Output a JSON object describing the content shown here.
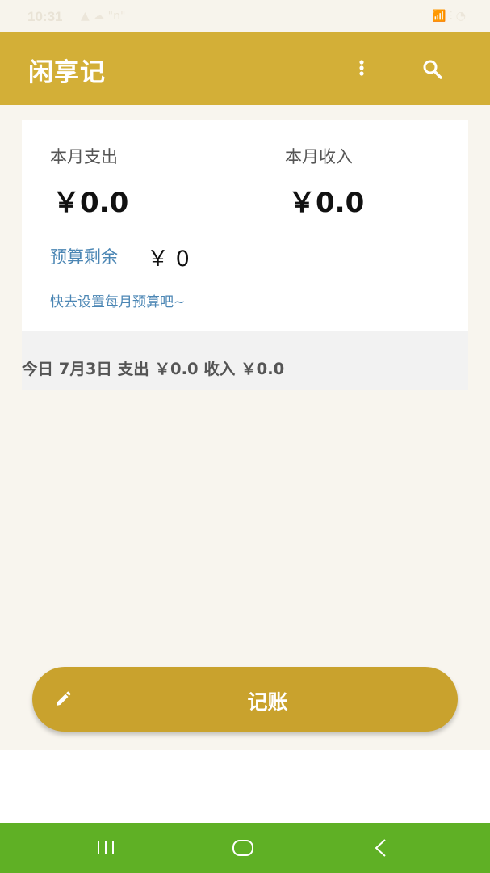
{
  "status_bar": {
    "time": "10:31",
    "left_icons": "▲ ☁ \"n\"",
    "right_icons": "📶 ⫶ ◔"
  },
  "app_bar": {
    "title": "闲享记",
    "icons": [
      "more-vert-icon",
      "search-icon"
    ]
  },
  "summary": {
    "expense_label": "本月支出",
    "expense_value": "￥0.0",
    "income_label": "本月收入",
    "income_value": "￥0.0",
    "budget_label": "预算剩余",
    "budget_value": "￥ 0",
    "budget_hint": "快去设置每月预算吧~"
  },
  "today": {
    "text": "今日 7月3日 支出 ￥0.0  收入 ￥0.0"
  },
  "record_button": {
    "label": "记账",
    "icon": "pencil-icon"
  },
  "nav": {
    "icons": [
      "recent-apps-icon",
      "home-icon",
      "back-icon"
    ]
  },
  "colors": {
    "app_bar": "#d3af37",
    "record_button": "#c9a22d",
    "link_text": "#4b86b4",
    "nav_bar": "#5fb025",
    "background": "#f8f5ee"
  }
}
